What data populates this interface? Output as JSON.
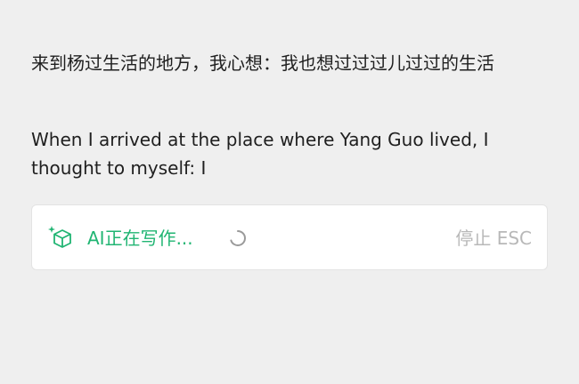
{
  "content": {
    "chinese_text": "来到杨过生活的地方，我心想：我也想过过过儿过过的生活",
    "english_text": "When I arrived at the place where Yang Guo lived, I thought to myself: I"
  },
  "ai_bar": {
    "status": "AI正在写作...",
    "stop_label": "停止 ESC",
    "icon": "ai-cube-sparkle-icon",
    "spinner": "loading-spinner-icon",
    "accent_color": "#21b573"
  }
}
